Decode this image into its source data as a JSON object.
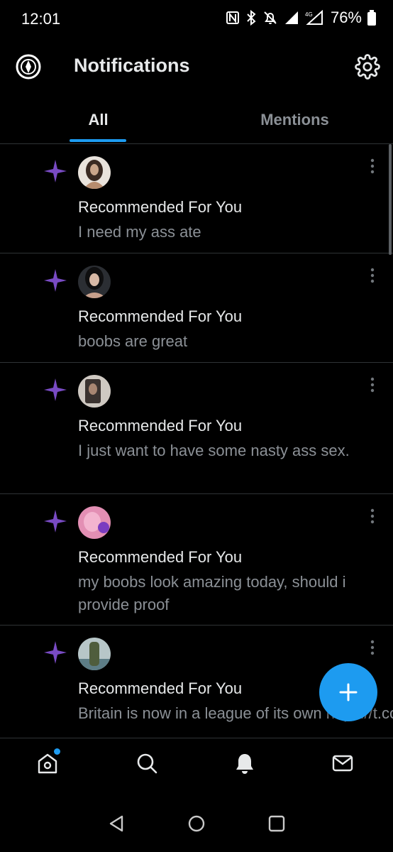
{
  "status_bar": {
    "time": "12:01",
    "battery": "76%",
    "icons": [
      "nfc-icon",
      "bluetooth-icon",
      "mute-icon",
      "signal-icon",
      "4g-signal-icon",
      "battery-icon"
    ]
  },
  "header": {
    "title": "Notifications",
    "logo_icon": "app-logo-icon",
    "settings_icon": "gear-icon"
  },
  "tabs": [
    {
      "label": "All",
      "selected": true
    },
    {
      "label": "Mentions",
      "selected": false
    }
  ],
  "notifications": [
    {
      "title": "Recommended For You",
      "body": "I need my ass ate",
      "icon": "sparkle-icon"
    },
    {
      "title": "Recommended For You",
      "body": "boobs are great",
      "icon": "sparkle-icon"
    },
    {
      "title": "Recommended For You",
      "body": "I just want to have some nasty ass sex.",
      "icon": "sparkle-icon"
    },
    {
      "title": "Recommended For You",
      "body": "my boobs look amazing today, should i provide proof",
      "icon": "sparkle-icon"
    },
    {
      "title": "Recommended For You",
      "body": "Britain is now in a league of its own https://t.co/fDzClEEAqU",
      "icon": "sparkle-icon"
    }
  ],
  "bottom_nav": [
    "home-icon",
    "search-icon",
    "bell-icon",
    "mail-icon"
  ],
  "colors": {
    "accent": "#1d9bf0",
    "sparkle": "#794bc4",
    "background": "#000000",
    "muted_text": "#8b9096"
  }
}
